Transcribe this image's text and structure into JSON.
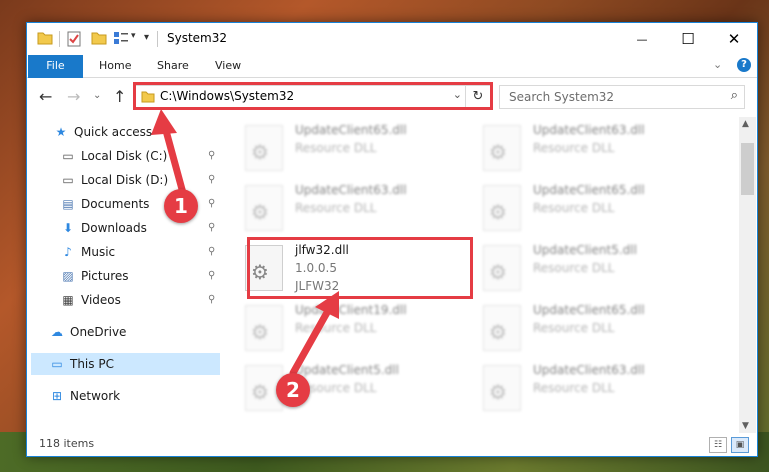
{
  "window": {
    "title": "System32",
    "controls": {
      "minimize": "—",
      "maximize": "☐",
      "close": "✕"
    }
  },
  "ribbon": {
    "tabs": [
      "File",
      "Home",
      "Share",
      "View"
    ],
    "help_icon": "?",
    "expand_icon": "⌄"
  },
  "navigation": {
    "back_icon": "←",
    "forward_icon": "→",
    "recent_icon": "⌄",
    "up_icon": "↑",
    "address_path": "C:\\Windows\\System32",
    "address_dropdown_icon": "⌄",
    "refresh_icon": "↻",
    "search_placeholder": "Search System32",
    "search_icon": "⌕"
  },
  "sidebar": {
    "items": [
      {
        "label": "Quick access",
        "icon": "★",
        "pinned": false
      },
      {
        "label": "Local Disk (C:)",
        "icon": "▭",
        "pinned": true
      },
      {
        "label": "Local Disk (D:)",
        "icon": "▭",
        "pinned": true
      },
      {
        "label": "Documents",
        "icon": "▤",
        "pinned": true
      },
      {
        "label": "Downloads",
        "icon": "⬇",
        "pinned": true
      },
      {
        "label": "Music",
        "icon": "♪",
        "pinned": true
      },
      {
        "label": "Pictures",
        "icon": "▨",
        "pinned": true
      },
      {
        "label": "Videos",
        "icon": "▦",
        "pinned": true
      },
      {
        "label": "OneDrive",
        "icon": "☁",
        "pinned": false
      },
      {
        "label": "This PC",
        "icon": "▭",
        "pinned": false
      },
      {
        "label": "Network",
        "icon": "⊞",
        "pinned": false
      }
    ],
    "pin_icon": "⚲"
  },
  "files": [
    {
      "name": "UpdateClient65.dll",
      "line2": "Resource DLL",
      "line3": ""
    },
    {
      "name": "UpdateClient63.dll",
      "line2": "Resource DLL",
      "line3": ""
    },
    {
      "name": "UpdateClient63.dll",
      "line2": "Resource DLL",
      "line3": ""
    },
    {
      "name": "UpdateClient65.dll",
      "line2": "Resource DLL",
      "line3": ""
    },
    {
      "name": "jlfw32.dll",
      "line2": "1.0.0.5",
      "line3": "JLFW32"
    },
    {
      "name": "UpdateClient5.dll",
      "line2": "Resource DLL",
      "line3": ""
    },
    {
      "name": "UpdateClient19.dll",
      "line2": "Resource DLL",
      "line3": ""
    },
    {
      "name": "UpdateClient65.dll",
      "line2": "Resource DLL",
      "line3": ""
    },
    {
      "name": "UpdateClient5.dll",
      "line2": "Resource DLL",
      "line3": ""
    },
    {
      "name": "UpdateClient63.dll",
      "line2": "Resource DLL",
      "line3": ""
    }
  ],
  "status": {
    "item_count": "118 items"
  },
  "callouts": {
    "one": "1",
    "two": "2"
  },
  "colors": {
    "accent": "#1979ca",
    "highlight": "#e53c44",
    "selected": "#cce8ff"
  }
}
